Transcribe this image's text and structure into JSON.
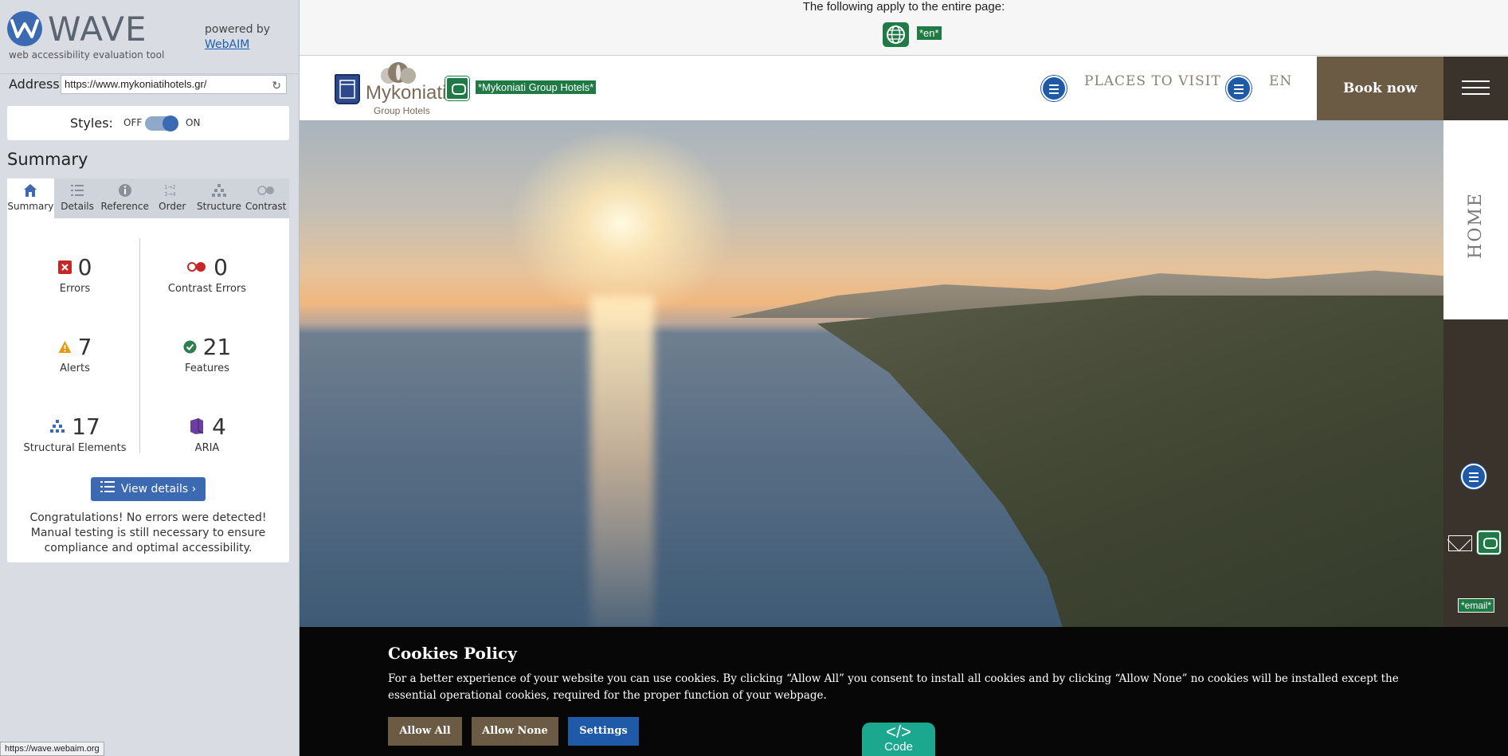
{
  "wave": {
    "name": "WAVE",
    "tagline": "web accessibility evaluation tool",
    "powered_by": "powered by",
    "webaim_link": "WebAIM",
    "address_label": "Address:",
    "address_value": "https://www.mykoniatihotels.gr/",
    "styles_label": "Styles:",
    "styles_off": "OFF",
    "styles_on": "ON",
    "summary_title": "Summary",
    "tabs": [
      "Summary",
      "Details",
      "Reference",
      "Order",
      "Structure",
      "Contrast"
    ],
    "stats": {
      "errors": {
        "count": "0",
        "label": "Errors"
      },
      "contrast": {
        "count": "0",
        "label": "Contrast Errors"
      },
      "alerts": {
        "count": "7",
        "label": "Alerts"
      },
      "features": {
        "count": "21",
        "label": "Features"
      },
      "structural": {
        "count": "17",
        "label": "Structural Elements"
      },
      "aria": {
        "count": "4",
        "label": "ARIA"
      }
    },
    "view_details": "View details ›",
    "congrats": "Congratulations! No errors were detected! Manual testing is still necessary to ensure compliance and optimal accessibility.",
    "status_url": "https://wave.webaim.org",
    "colors": {
      "accent": "#3b6ab3",
      "error": "#c62828",
      "alert": "#e39b16",
      "feature": "#2e7d4f",
      "aria": "#6a3fa0"
    }
  },
  "site": {
    "page_notice": "The following apply to the entire page:",
    "lang_tag": "*en*",
    "logo_text": "Mykoniati",
    "logo_sub": "Group Hotels",
    "logo_link_label": "*Mykoniati Group Hotels*",
    "nav_places": "PLACES TO VISIT",
    "nav_lang": "EN",
    "book_now": "Book now",
    "side_home": "HOME",
    "email_tag": "*email*",
    "colors": {
      "brand_brown": "#6b5a44",
      "dark": "#3a332c",
      "wave_green": "#1f7a45",
      "wave_blue": "#1e5aa8"
    }
  },
  "cookies": {
    "title": "Cookies Policy",
    "text": "For a better experience of your website you can use cookies. By clicking “Allow All” you consent to install all cookies and by clicking “Allow None” no cookies will be installed except the essential operational cookies, required for the proper function of your webpage.",
    "allow_all": "Allow All",
    "allow_none": "Allow None",
    "settings": "Settings",
    "code_symbol": "</>",
    "code_label": "Code"
  }
}
